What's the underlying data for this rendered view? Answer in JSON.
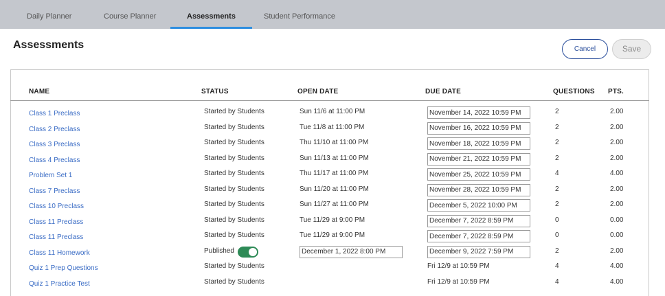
{
  "nav": {
    "tabs": [
      {
        "label": "Daily Planner"
      },
      {
        "label": "Course Planner"
      },
      {
        "label": "Assessments",
        "active": true
      },
      {
        "label": "Student Performance"
      }
    ]
  },
  "page": {
    "title": "Assessments",
    "cancel_label": "Cancel",
    "save_label": "Save"
  },
  "table": {
    "headers": {
      "name": "NAME",
      "status": "STATUS",
      "open_date": "OPEN DATE",
      "due_date": "DUE DATE",
      "questions": "QUESTIONS",
      "pts": "PTS."
    },
    "rows": [
      {
        "name": "Class 1 Preclass",
        "status": "Started by Students",
        "open": "Sun 11/6 at 11:00 PM",
        "due": "November 14, 2022 10:59 PM",
        "due_editable": true,
        "questions": "2",
        "pts": "2.00"
      },
      {
        "name": "Class 2 Preclass",
        "status": "Started by Students",
        "open": "Tue 11/8 at 11:00 PM",
        "due": "November 16, 2022 10:59 PM",
        "due_editable": true,
        "questions": "2",
        "pts": "2.00"
      },
      {
        "name": "Class 3 Preclass",
        "status": "Started by Students",
        "open": "Thu 11/10 at 11:00 PM",
        "due": "November 18, 2022 10:59 PM",
        "due_editable": true,
        "questions": "2",
        "pts": "2.00"
      },
      {
        "name": "Class 4 Preclass",
        "status": "Started by Students",
        "open": "Sun 11/13 at 11:00 PM",
        "due": "November 21, 2022 10:59 PM",
        "due_editable": true,
        "questions": "2",
        "pts": "2.00"
      },
      {
        "name": "Problem Set 1",
        "status": "Started by Students",
        "open": "Thu 11/17 at 11:00 PM",
        "due": "November 25, 2022 10:59 PM",
        "due_editable": true,
        "questions": "4",
        "pts": "4.00"
      },
      {
        "name": "Class 7 Preclass",
        "status": "Started by Students",
        "open": "Sun 11/20 at 11:00 PM",
        "due": "November 28, 2022 10:59 PM",
        "due_editable": true,
        "questions": "2",
        "pts": "2.00"
      },
      {
        "name": "Class 10 Preclass",
        "status": "Started by Students",
        "open": "Sun 11/27 at 11:00 PM",
        "due": "December 5, 2022 10:00 PM",
        "due_editable": true,
        "questions": "2",
        "pts": "2.00"
      },
      {
        "name": "Class 11 Preclass",
        "status": "Started by Students",
        "open": "Tue 11/29 at 9:00 PM",
        "due": "December 7, 2022 8:59 PM",
        "due_editable": true,
        "questions": "0",
        "pts": "0.00"
      },
      {
        "name": "Class 11 Preclass",
        "status": "Started by Students",
        "open": "Tue 11/29 at 9:00 PM",
        "due": "December 7, 2022 8:59 PM",
        "due_editable": true,
        "questions": "0",
        "pts": "0.00"
      },
      {
        "name": "Class 11 Homework",
        "status": "Published",
        "published_toggle": true,
        "open": "December 1, 2022 8:00 PM",
        "open_editable": true,
        "due": "December 9, 2022 7:59 PM",
        "due_editable": true,
        "questions": "2",
        "pts": "2.00"
      },
      {
        "name": "Quiz 1 Prep Questions",
        "status": "Started by Students",
        "open": "",
        "due": "Fri 12/9 at 10:59 PM",
        "due_editable": false,
        "questions": "4",
        "pts": "4.00"
      },
      {
        "name": "Quiz 1 Practice Test",
        "status": "Started by Students",
        "open": "",
        "due": "Fri 12/9 at 10:59 PM",
        "due_editable": false,
        "questions": "4",
        "pts": "4.00"
      }
    ]
  },
  "colors": {
    "nav_bg": "#c4c7cd",
    "active_tab_underline": "#2e8ee0",
    "link": "#3a6cc5",
    "cancel_border": "#2b4f9c",
    "toggle_on": "#2e8b57"
  }
}
